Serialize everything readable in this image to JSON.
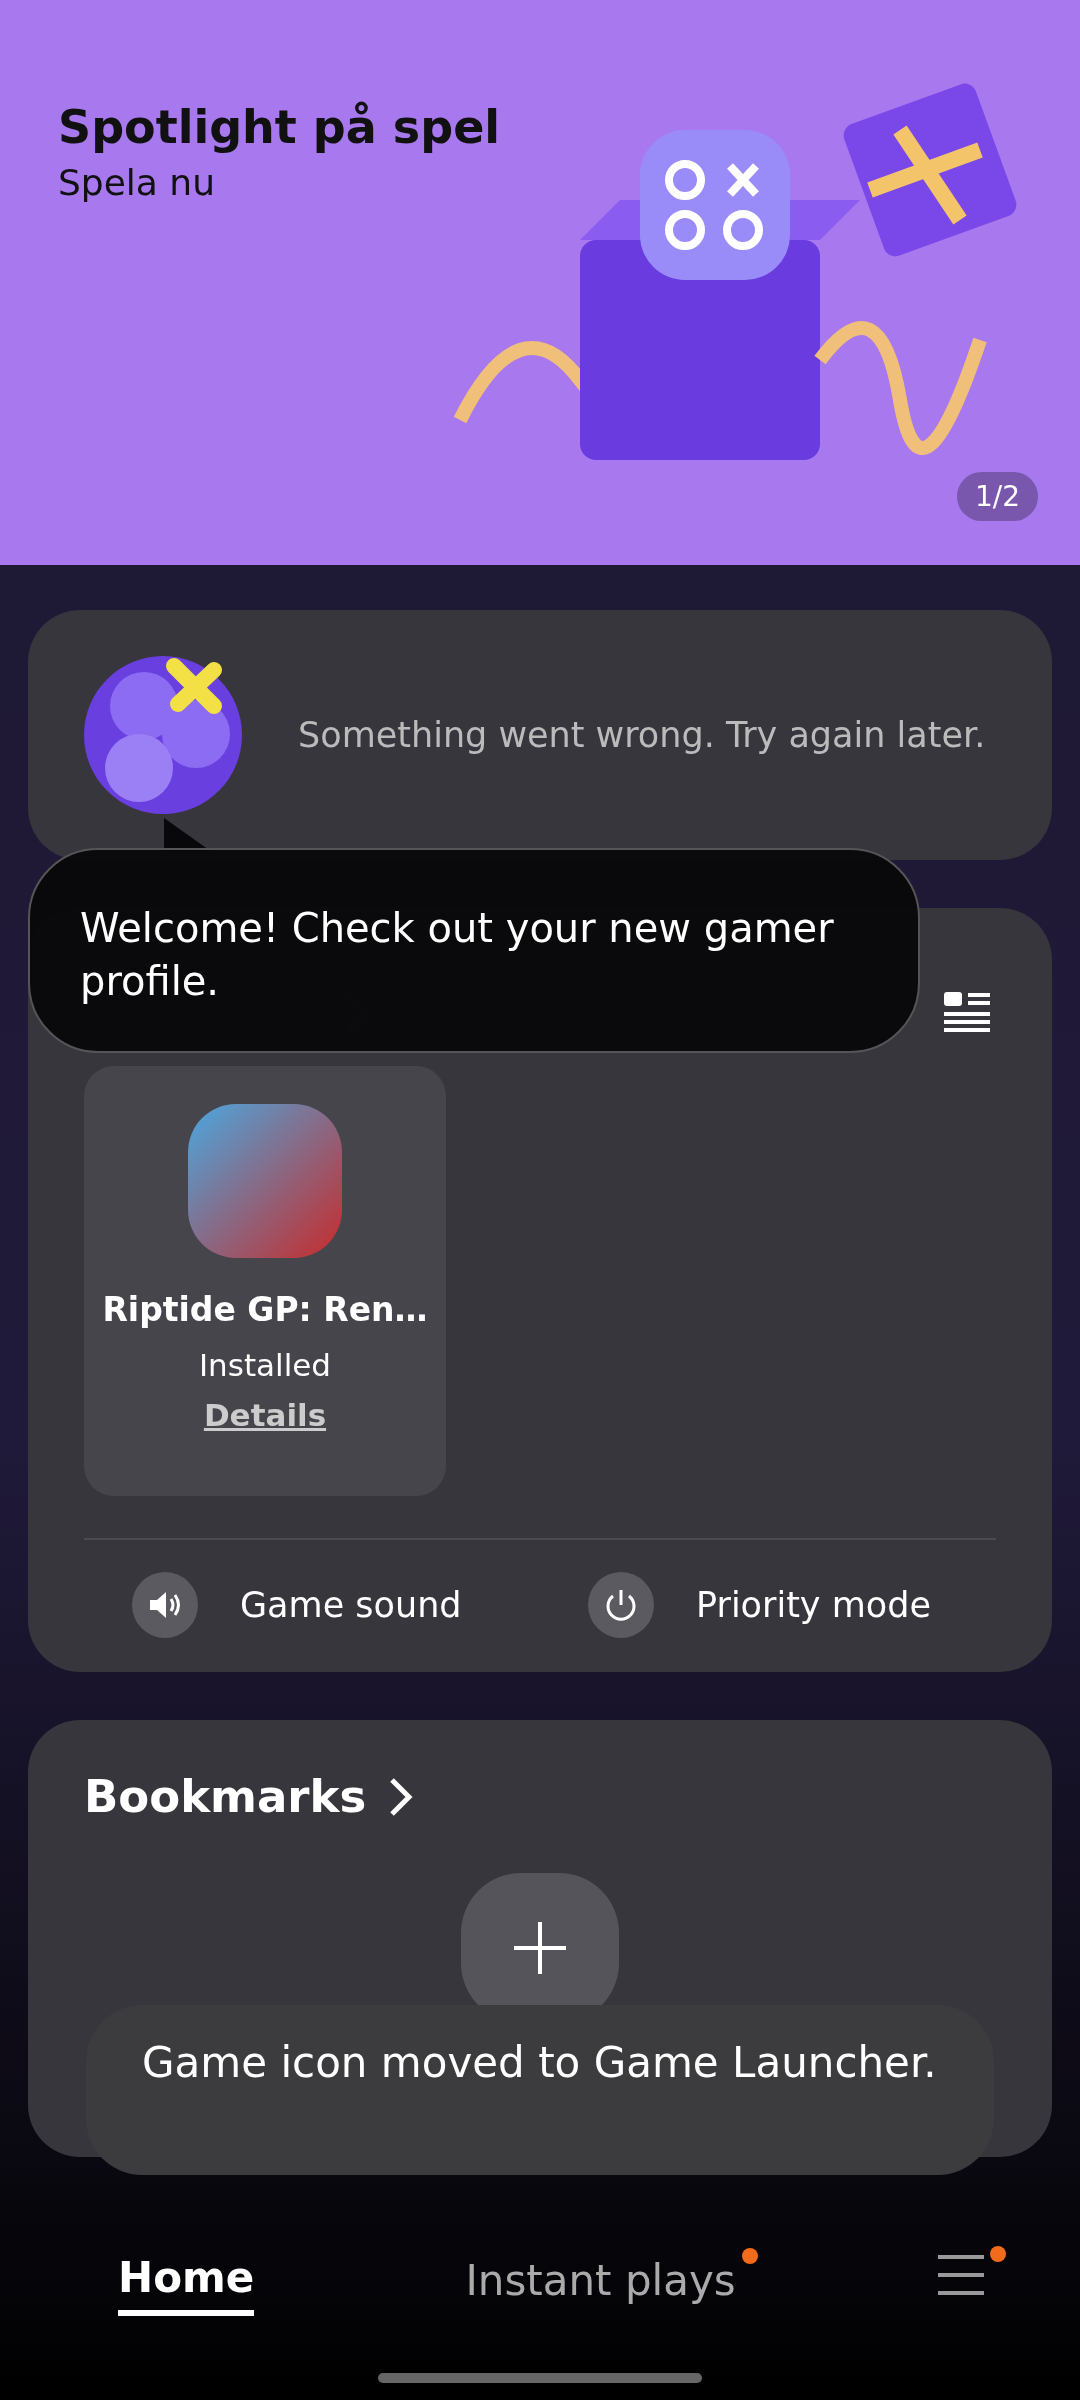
{
  "banner": {
    "title": "Spotlight på spel",
    "subtitle": "Spela nu",
    "counter": "1/2"
  },
  "profile": {
    "message": "Something went wrong. Try again later."
  },
  "tooltip": {
    "text": "Welcome! Check out your new gamer profile."
  },
  "my_games": {
    "games": [
      {
        "name": "Riptide GP: Ren…",
        "status": "Installed",
        "link": "Details"
      }
    ],
    "quick_settings": [
      {
        "kind": "sound",
        "label": "Game sound"
      },
      {
        "kind": "power",
        "label": "Priority mode"
      }
    ]
  },
  "bookmarks": {
    "title": "Bookmarks"
  },
  "toast": {
    "text": "Game icon moved to Game Launcher."
  },
  "bottom_nav": [
    {
      "kind": "text",
      "label": "Home",
      "selected": true,
      "badge": false
    },
    {
      "kind": "text",
      "label": "Instant plays",
      "selected": false,
      "badge": true
    },
    {
      "kind": "menu",
      "selected": false,
      "badge": true
    }
  ]
}
